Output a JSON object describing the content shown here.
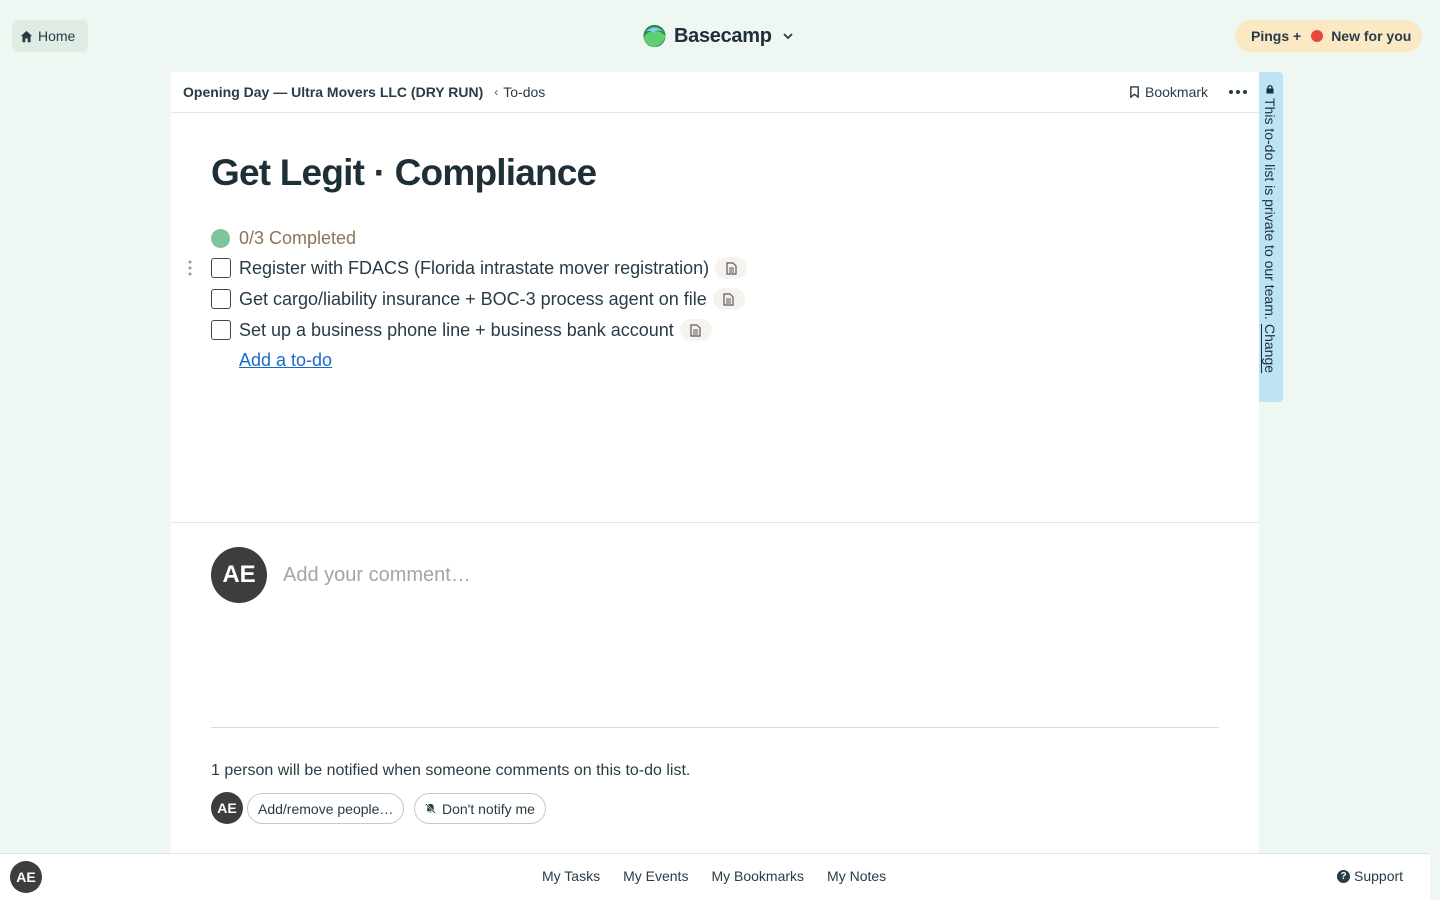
{
  "nav": {
    "home_label": "Home",
    "brand": "Basecamp",
    "pings_label": "Pings +",
    "new_for_you_label": "New for you"
  },
  "breadcrumb": {
    "project": "Opening Day — Ultra Movers LLC (DRY RUN)",
    "separator": "‹",
    "section": "To-dos"
  },
  "header": {
    "bookmark_label": "Bookmark"
  },
  "todolist": {
    "title": "Get Legit · Compliance",
    "progress": "0/3 Completed",
    "items": [
      {
        "label": "Register with FDACS (Florida intrastate mover registration)",
        "completed": false
      },
      {
        "label": "Get cargo/liability insurance + BOC-3 process agent on file",
        "completed": false
      },
      {
        "label": "Set up a business phone line + business bank account",
        "completed": false
      }
    ],
    "add_todo_label": "Add a to-do"
  },
  "comment": {
    "avatar_initials": "AE",
    "placeholder": "Add your comment…"
  },
  "notify": {
    "text": "1 person will be notified when someone comments on this to-do list.",
    "avatar_initials": "AE",
    "add_remove_label": "Add/remove people…",
    "dont_notify_label": "Don't notify me"
  },
  "private_notice": {
    "text": "This to-do list is private to our team.",
    "change_label": "Change"
  },
  "bottom_bar": {
    "avatar_initials": "AE",
    "links": [
      "My Tasks",
      "My Events",
      "My Bookmarks",
      "My Notes"
    ],
    "support_label": "Support"
  },
  "colors": {
    "background": "#eef7f1",
    "progress_dot": "#7ec59b",
    "link": "#1b6ac9",
    "ping_dot": "#e8473c",
    "private_tab": "#bde3f5"
  }
}
